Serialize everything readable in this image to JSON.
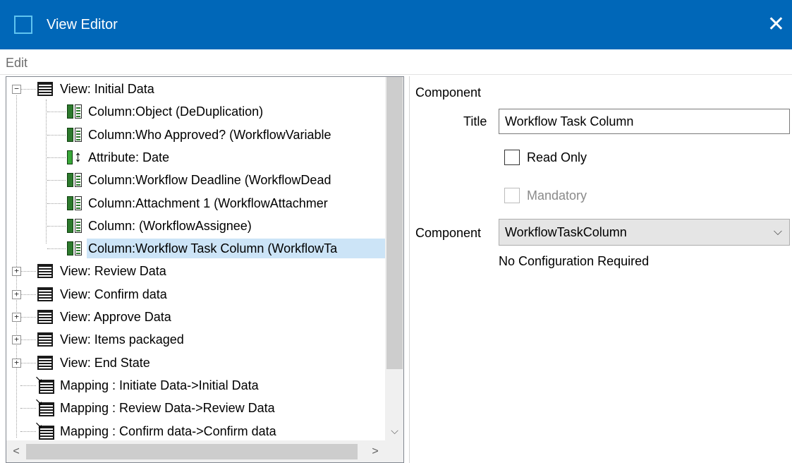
{
  "window": {
    "title": "View Editor",
    "close_glyph": "✕"
  },
  "menu": {
    "items": [
      {
        "label": "Edit"
      }
    ]
  },
  "tree": {
    "nodes": [
      {
        "label": "View: Initial Data",
        "icon": "list-icon",
        "expander": "−"
      },
      {
        "label": "Column:Object (DeDuplication)",
        "icon": "column-icon"
      },
      {
        "label": "Column:Who Approved? (WorkflowVariable",
        "icon": "column-icon"
      },
      {
        "label": "Attribute: Date",
        "icon": "attribute-icon"
      },
      {
        "label": "Column:Workflow Deadline (WorkflowDead",
        "icon": "column-icon"
      },
      {
        "label": "Column:Attachment 1 (WorkflowAttachmer",
        "icon": "column-icon"
      },
      {
        "label": "Column: (WorkflowAssignee)",
        "icon": "column-icon"
      },
      {
        "label": "Column:Workflow Task Column (WorkflowTa",
        "icon": "column-icon",
        "selected": true
      },
      {
        "label": "View: Review Data",
        "icon": "list-icon",
        "expander": "+"
      },
      {
        "label": "View: Confirm data",
        "icon": "list-icon",
        "expander": "+"
      },
      {
        "label": "View: Approve Data",
        "icon": "list-icon",
        "expander": "+"
      },
      {
        "label": "View: Items packaged",
        "icon": "list-icon",
        "expander": "+"
      },
      {
        "label": "View: End State",
        "icon": "list-icon",
        "expander": "+"
      },
      {
        "label": "Mapping : Initiate Data->Initial Data",
        "icon": "mapping-icon"
      },
      {
        "label": "Mapping : Review Data->Review Data",
        "icon": "mapping-icon"
      },
      {
        "label": "Mapping : Confirm data->Confirm data",
        "icon": "mapping-icon"
      }
    ],
    "scroll": {
      "up_glyph": "",
      "down_glyph": "⌵",
      "left_glyph": "<",
      "right_glyph": ">"
    }
  },
  "component_panel": {
    "header": "Component",
    "title_label": "Title",
    "title_value": "Workflow Task Column",
    "read_only": {
      "label": "Read Only",
      "checked": false
    },
    "mandatory": {
      "label": "Mandatory",
      "checked": false,
      "disabled": true
    },
    "component_label": "Component",
    "component_value": "WorkflowTaskColumn",
    "component_chevron": "⌵",
    "config_note": "No Configuration Required"
  }
}
